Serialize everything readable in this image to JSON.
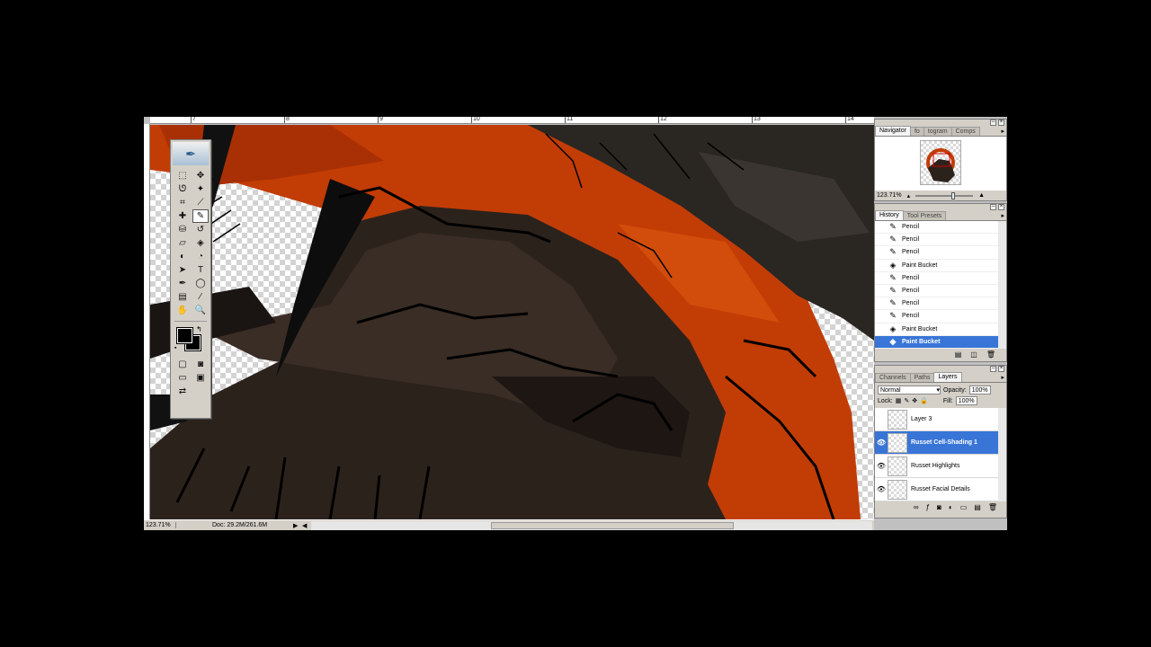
{
  "ruler": {
    "marks": [
      "7",
      "8",
      "9",
      "10",
      "11",
      "12",
      "13",
      "14"
    ]
  },
  "statusbar": {
    "zoom": "123.71%",
    "doc": "Doc: 29.2M/261.6M",
    "arrow": "▶",
    "scroll_left": "◀"
  },
  "toolbox": {
    "logo_icon": "feather-icon",
    "tools": [
      {
        "name": "marquee-tool",
        "glyph": "⬚"
      },
      {
        "name": "move-tool",
        "glyph": "✥"
      },
      {
        "name": "lasso-tool",
        "glyph": "ᘎ"
      },
      {
        "name": "magic-wand-tool",
        "glyph": "✦"
      },
      {
        "name": "crop-tool",
        "glyph": "⌗"
      },
      {
        "name": "slice-tool",
        "glyph": "⟋"
      },
      {
        "name": "healing-brush-tool",
        "glyph": "✚"
      },
      {
        "name": "pencil-tool",
        "glyph": "✎"
      },
      {
        "name": "clone-stamp-tool",
        "glyph": "⛁"
      },
      {
        "name": "history-brush-tool",
        "glyph": "↺"
      },
      {
        "name": "eraser-tool",
        "glyph": "▱"
      },
      {
        "name": "paint-bucket-tool",
        "glyph": "◈"
      },
      {
        "name": "blur-tool",
        "glyph": "◐"
      },
      {
        "name": "dodge-tool",
        "glyph": "◔"
      },
      {
        "name": "path-selection-tool",
        "glyph": "➤"
      },
      {
        "name": "type-tool",
        "glyph": "T"
      },
      {
        "name": "pen-tool",
        "glyph": "✒"
      },
      {
        "name": "shape-tool",
        "glyph": "◯"
      },
      {
        "name": "notes-tool",
        "glyph": "▤"
      },
      {
        "name": "eyedropper-tool",
        "glyph": "⁄"
      },
      {
        "name": "hand-tool",
        "glyph": "✋"
      },
      {
        "name": "zoom-tool",
        "glyph": "🔍"
      }
    ],
    "active_tool": "pencil-tool",
    "foreground_color": "#000000",
    "background_color": "#000000",
    "swap_glyph": "↰",
    "default_glyph": "▪"
  },
  "navigator": {
    "tabs": [
      "Navigator",
      "Info",
      "Histogram",
      "Comps"
    ],
    "tabs_visible": [
      "Navigator",
      "fo",
      "togram",
      "Comps"
    ],
    "zoom": "123.71%"
  },
  "history": {
    "tabs": [
      "History",
      "Tool Presets"
    ],
    "items": [
      {
        "label": "Pencil",
        "icon": "pencil-icon"
      },
      {
        "label": "Pencil",
        "icon": "pencil-icon"
      },
      {
        "label": "Pencil",
        "icon": "pencil-icon"
      },
      {
        "label": "Paint Bucket",
        "icon": "paint-bucket-icon"
      },
      {
        "label": "Pencil",
        "icon": "pencil-icon"
      },
      {
        "label": "Pencil",
        "icon": "pencil-icon"
      },
      {
        "label": "Pencil",
        "icon": "pencil-icon"
      },
      {
        "label": "Pencil",
        "icon": "pencil-icon"
      },
      {
        "label": "Paint Bucket",
        "icon": "paint-bucket-icon"
      },
      {
        "label": "Paint Bucket",
        "icon": "paint-bucket-icon",
        "active": true
      }
    ]
  },
  "layers": {
    "tabs": [
      "Channels",
      "Paths",
      "Layers"
    ],
    "blend_mode": "Normal",
    "opacity_label": "Opacity:",
    "opacity": "100%",
    "lock_label": "Lock:",
    "fill_label": "Fill:",
    "fill": "100%",
    "items": [
      {
        "name": "Layer 3",
        "visible": false
      },
      {
        "name": "Russet Cell-Shading 1",
        "visible": true,
        "active": true
      },
      {
        "name": "Russet Highlights",
        "visible": true
      },
      {
        "name": "Russet Facial Details",
        "visible": true
      }
    ]
  },
  "colors": {
    "selection": "#3875d7",
    "orange": "#c23c06",
    "fur": "#2c221c"
  }
}
